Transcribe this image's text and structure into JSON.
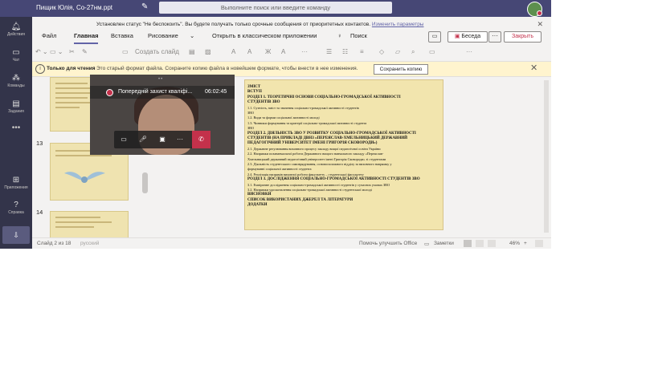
{
  "window": {
    "title": "Пищик Юлія, Со-27нм.ppt",
    "search_placeholder": "Выполните поиск или введите команду"
  },
  "rail": {
    "items": [
      {
        "label": "Действия",
        "icon": "bell-icon"
      },
      {
        "label": "Чат",
        "icon": "chat-icon"
      },
      {
        "label": "Команды",
        "icon": "teams-icon"
      },
      {
        "label": "Задания",
        "icon": "assignments-icon"
      },
      {
        "label": "Приложения",
        "icon": "apps-icon"
      },
      {
        "label": "Справка",
        "icon": "help-icon"
      }
    ],
    "more": "•••"
  },
  "status_banner": {
    "text": "Установлен статус \"Не беспокоить\". Вы будете получать только срочные сообщения от приоритетных контактов.",
    "link": "Изменить параметры"
  },
  "ribbon": {
    "tabs": [
      "Файл",
      "Главная",
      "Вставка",
      "Рисование"
    ],
    "open_desktop": "Открыть в классическом приложении",
    "search_label": "Поиск",
    "beseda": "Беседа",
    "close": "Закрыть"
  },
  "toolbar": {
    "new_slide": "Создать слайд"
  },
  "readonly_bar": {
    "bold": "Только для чтения",
    "message": "Это старый формат файла. Сохраните копию файла в новейшем формате, чтобы внести в нее изменения.",
    "save_copy": "Сохранить копию"
  },
  "thumbnails": {
    "numbers": [
      "13",
      "14"
    ]
  },
  "video": {
    "title": "Попередній захист кваліфі...",
    "time": "06:02:45"
  },
  "slide": {
    "lines": [
      {
        "t": "ЗМІСТ",
        "h": true
      },
      {
        "t": "ВСТУП",
        "h": true
      },
      {
        "t": "РОЗДІЛ 1. ТЕОРЕТИЧНІ ОСНОВИ СОЦІАЛЬНО-ГРОМАДСЬКОЇ АКТИВНОСТІ",
        "h": true
      },
      {
        "t": "СТУДЕНТІВ ЗВО",
        "h": true
      },
      {
        "t": "1.1. Сутність, зміст та значення соціально-громадської активності студентів",
        "h": false
      },
      {
        "t": "ЗВО",
        "h": false
      },
      {
        "t": "1.2. Види та форми соціальної активності молоді",
        "h": false
      },
      {
        "t": "1.3. Чинники формування та критерії соціально-громадської активності студента",
        "h": false
      },
      {
        "t": "ЗВО",
        "h": false
      },
      {
        "t": "РОЗДІЛ 2. ДІЯЛЬНІСТЬ ЗВО У РОЗВИТКУ СОЦІАЛЬНО-ГРОМАДСЬКОЇ АКТИВНОСТІ",
        "h": true
      },
      {
        "t": "СТУДЕНТІВ (НА ПРИКЛАДІ ДВНЗ «ПЕРЕЯСЛАВ-ХМЕЛЬНИЦЬКИЙ ДЕРЖАВНИЙ",
        "h": true
      },
      {
        "t": "ПЕДАГОГІЧНИЙ УНІВЕРСИТЕТ ІМЕНІ ГРИГОРІЯ СКОВОРОДИ»)",
        "h": true
      },
      {
        "t": "2.1. Державне регулювання виховного процесу закладу вищої педагогічної освіти України",
        "h": false
      },
      {
        "t": "2.2. Напрямки позанавчальної роботи Державного вищого навчального закладу «Переяслав-",
        "h": false
      },
      {
        "t": "Хмельницький державний педагогічний університет імені Григорія Сковороди» зі студентами",
        "h": false
      },
      {
        "t": "2.3. Діяльність студентського самоврядування, основоположного відділу за виховного напрямку у",
        "h": false
      },
      {
        "t": "формуванні соціальної активності студента",
        "h": false
      },
      {
        "t": "2.4. Реалізація напрямів виховної роботи факультету – студентської фасультету",
        "h": false
      },
      {
        "t": "РОЗДІЛ 3. ДОСЛІДЖЕННЯ СОЦІАЛЬНО-ГРОМАДСЬКОЇ АКТИВНОСТІ СТУДЕНТІВ ЗВО",
        "h": true
      },
      {
        "t": "3.1. Емпіричне дослідження соціально-громадської активності студентів у сучасних умовах ЗВО",
        "h": false
      },
      {
        "t": "3.2. Напрямки удосконалення соціально-громадської активності студентської молоді",
        "h": false
      },
      {
        "t": "ВИСНОВКИ",
        "h": true
      },
      {
        "t": "СПИСОК ВИКОРИСТАНИХ ДЖЕРЕЛ ТА ЛІТЕРАТУРИ",
        "h": true
      },
      {
        "t": "ДОДАТКИ",
        "h": true
      }
    ]
  },
  "statusbar": {
    "slide_of": "Слайд 2 из 18",
    "language": "русский",
    "improve": "Помочь улучшить Office",
    "notes": "Заметки",
    "zoom": "46%"
  }
}
